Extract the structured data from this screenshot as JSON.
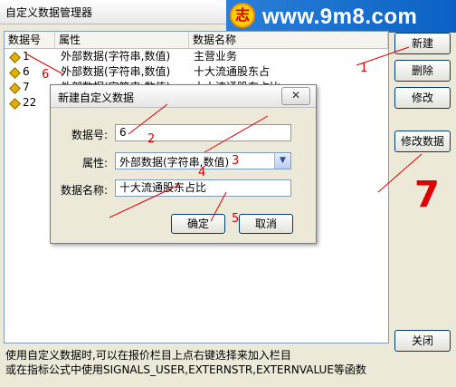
{
  "window": {
    "title": "自定义数据管理器"
  },
  "logo": {
    "text": "www.9m8.com",
    "icon_glyph": "志"
  },
  "table": {
    "columns": [
      "数据号",
      "属性",
      "数据名称"
    ],
    "rows": [
      {
        "id": "1",
        "attr": "外部数据(字符串,数值)",
        "name": "主营业务"
      },
      {
        "id": "6",
        "attr": "外部数据(字符串,数值)",
        "name": "十大流通股东占"
      },
      {
        "id": "7",
        "attr": "外部数据(字符串,数值)",
        "name": "十大流通股东占比"
      },
      {
        "id": "22",
        "attr": "",
        "name": ""
      }
    ]
  },
  "buttons": {
    "new": "新建",
    "delete": "删除",
    "modify": "修改",
    "modify_data": "修改数据",
    "close": "关闭"
  },
  "status": {
    "line1": "使用自定义数据时,可以在报价栏目上点右键选择来加入栏目",
    "line2": "或在指标公式中使用SIGNALS_USER,EXTERNSTR,EXTERNVALUE等函数"
  },
  "dialog": {
    "title": "新建自定义数据",
    "id_label": "数据号:",
    "id_value": "6",
    "attr_label": "属性:",
    "attr_value": "外部数据(字符串,数值)",
    "name_label": "数据名称:",
    "name_value": "十大流通股东占比",
    "ok": "确定",
    "cancel": "取消"
  },
  "annotations": {
    "n1": "1",
    "n2": "2",
    "n3": "3",
    "n4": "4",
    "n5": "5",
    "n6": "6",
    "n7": "7"
  },
  "colors": {
    "annotation": "#e00000",
    "titlebar": "#ffffff",
    "accent": "#003c74"
  }
}
